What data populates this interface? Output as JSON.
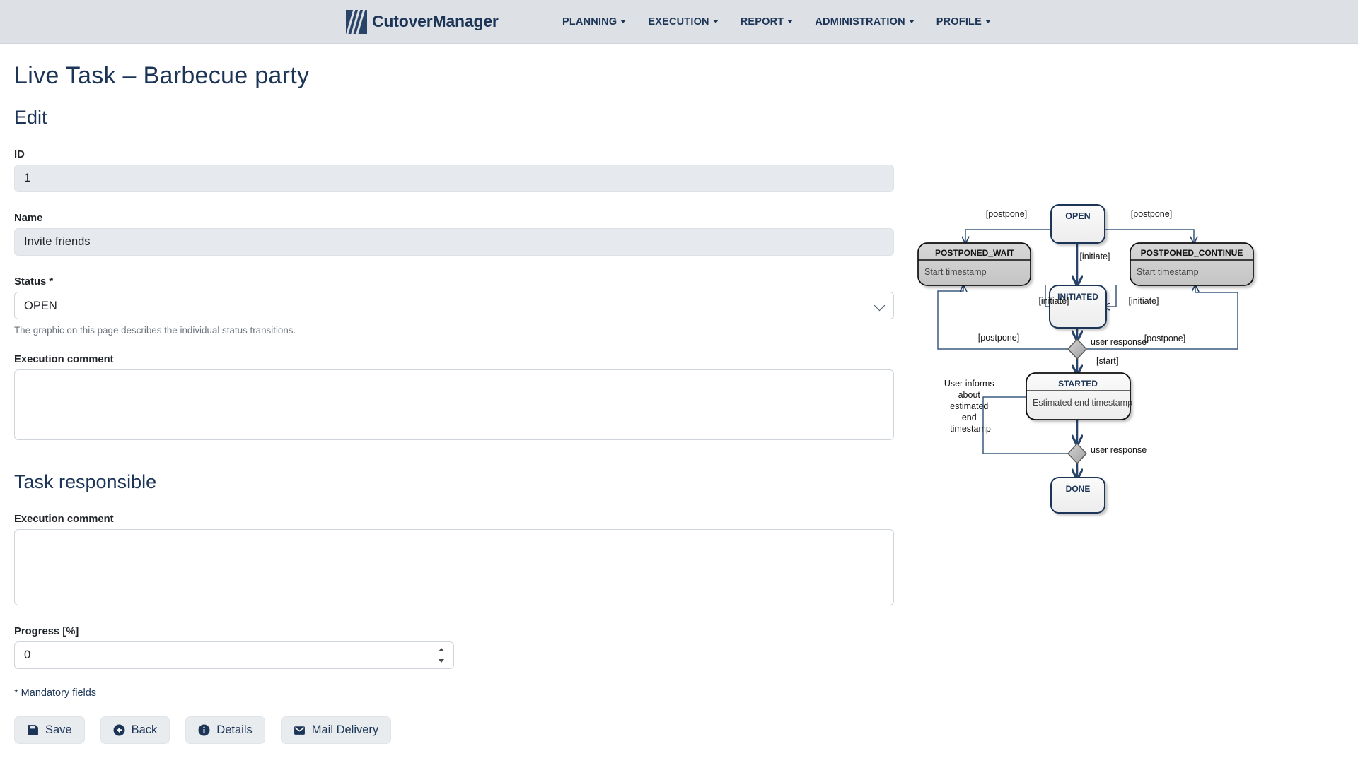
{
  "navbar": {
    "brand": "CutoverManager",
    "logo_icon": "diagonal-slashes-logo",
    "items": [
      {
        "label": "PLANNING"
      },
      {
        "label": "EXECUTION"
      },
      {
        "label": "REPORT"
      },
      {
        "label": "ADMINISTRATION"
      },
      {
        "label": "PROFILE"
      }
    ]
  },
  "page": {
    "title": "Live Task  –  Barbecue party",
    "section_title": "Edit",
    "responsible_title": "Task responsible",
    "mandatory_note": "* Mandatory fields"
  },
  "form": {
    "id": {
      "label": "ID",
      "value": "1"
    },
    "name": {
      "label": "Name",
      "value": "Invite friends"
    },
    "status": {
      "label": "Status *",
      "value": "OPEN",
      "options": [
        "OPEN",
        "INITIATED",
        "POSTPONED_WAIT",
        "POSTPONED_CONTINUE",
        "STARTED",
        "DONE"
      ],
      "help": "The graphic on this page describes the individual status transitions."
    },
    "execution_comment": {
      "label": "Execution comment",
      "value": "",
      "placeholder": ""
    },
    "execution_comment_responsible": {
      "label": "Execution comment",
      "value": "",
      "placeholder": ""
    },
    "progress": {
      "label": "Progress [%]",
      "value": "0"
    }
  },
  "buttons": [
    {
      "label": "Save",
      "icon": "floppy-disk-icon"
    },
    {
      "label": "Back",
      "icon": "arrow-left-circle-icon"
    },
    {
      "label": "Details",
      "icon": "info-circle-icon"
    },
    {
      "label": "Mail Delivery",
      "icon": "envelope-icon"
    }
  ],
  "diagram": {
    "type": "state-machine",
    "nodes": [
      {
        "id": "open",
        "title": "OPEN",
        "body": "",
        "style": "light"
      },
      {
        "id": "postponed_wait",
        "title": "POSTPONED_WAIT",
        "body": "Start timestamp",
        "style": "gray"
      },
      {
        "id": "postponed_continue",
        "title": "POSTPONED_CONTINUE",
        "body": "Start timestamp",
        "style": "gray"
      },
      {
        "id": "initiated",
        "title": "INITIATED",
        "body": "",
        "style": "light"
      },
      {
        "id": "started",
        "title": "STARTED",
        "body": "Estimated end timestamp",
        "style": "light"
      },
      {
        "id": "done",
        "title": "DONE",
        "body": "",
        "style": "light"
      }
    ],
    "decisions": [
      {
        "id": "d1",
        "label": "user response"
      },
      {
        "id": "d2",
        "label": "user response"
      }
    ],
    "edge_labels": [
      "[postpone]",
      "[postpone]",
      "[initiate]",
      "[initiate]",
      "[initiate]",
      "[postpone]",
      "[postpone]",
      "[start]"
    ],
    "note": "User informs about estimated end timestamp",
    "colors": {
      "line": "#3b5a80",
      "node_border": "#1c3557",
      "gray_fill": "#cdcdcd",
      "light_fill": "#f4f4f4",
      "title_blue": "#1c3557",
      "title_black": "#111111"
    }
  }
}
